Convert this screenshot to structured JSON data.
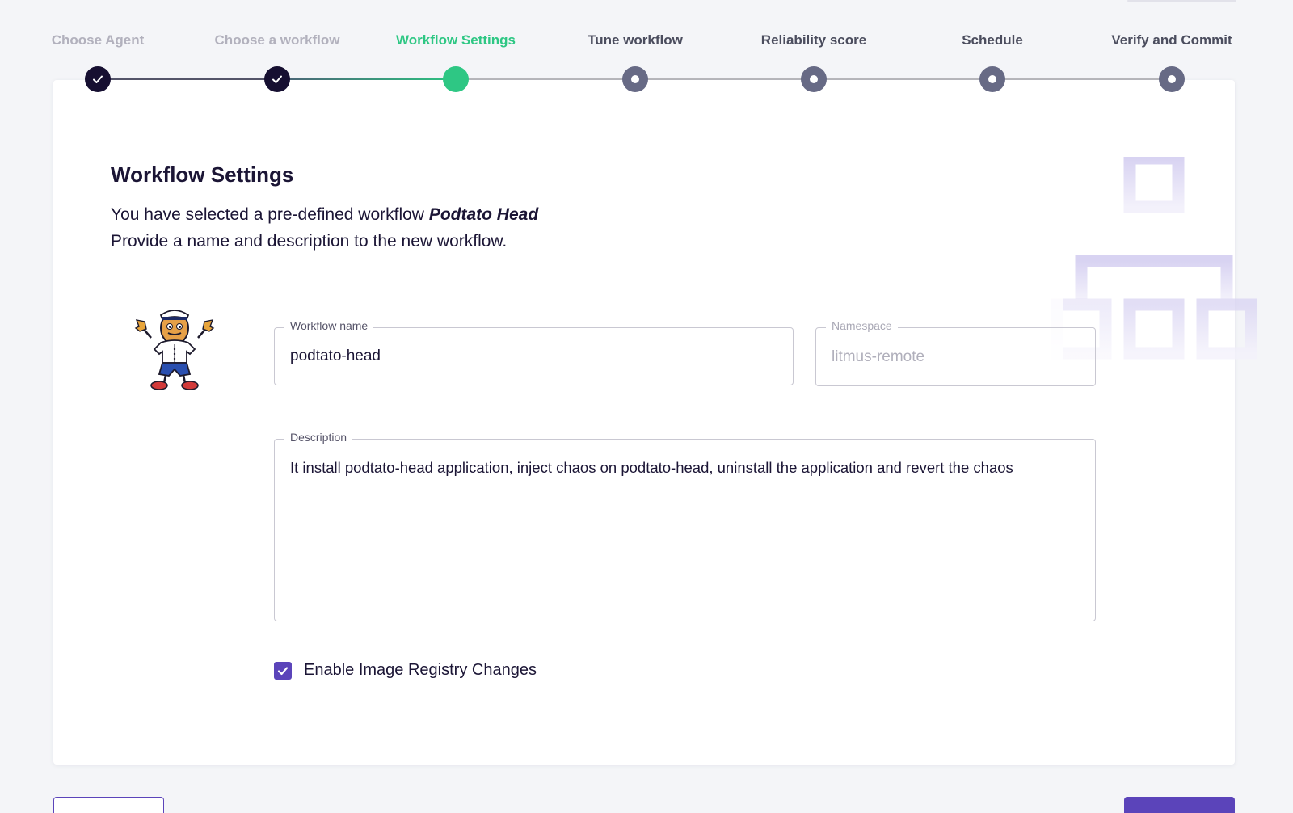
{
  "stepper": {
    "steps": [
      {
        "label": "Choose Agent",
        "state": "done"
      },
      {
        "label": "Choose a workflow",
        "state": "done"
      },
      {
        "label": "Workflow Settings",
        "state": "active"
      },
      {
        "label": "Tune workflow",
        "state": "pending"
      },
      {
        "label": "Reliability score",
        "state": "pending"
      },
      {
        "label": "Schedule",
        "state": "pending"
      },
      {
        "label": "Verify and Commit",
        "state": "pending"
      }
    ]
  },
  "main": {
    "heading": "Workflow Settings",
    "subtitle_prefix": "You have selected a pre-defined workflow ",
    "selected_workflow": "Podtato Head",
    "subtitle_line2": "Provide a name and description to the new workflow."
  },
  "form": {
    "workflow_name": {
      "label": "Workflow name",
      "value": "podtato-head"
    },
    "namespace": {
      "label": "Namespace",
      "value": "litmus-remote"
    },
    "description": {
      "label": "Description",
      "value": "It install podtato-head application, inject chaos on podtato-head, uninstall the application  and revert the chaos"
    },
    "enable_registry": {
      "label": "Enable Image Registry Changes",
      "checked": true
    }
  },
  "colors": {
    "accent": "#5b44ba",
    "active_step": "#2ec784",
    "done_step": "#160f31",
    "pending_step": "#676a85"
  },
  "icons": {
    "step_done": "check-icon",
    "checkbox": "checkmark-icon",
    "illustration": "podtato-head-mascot",
    "background_graphic": "workflow-tree-icon"
  }
}
